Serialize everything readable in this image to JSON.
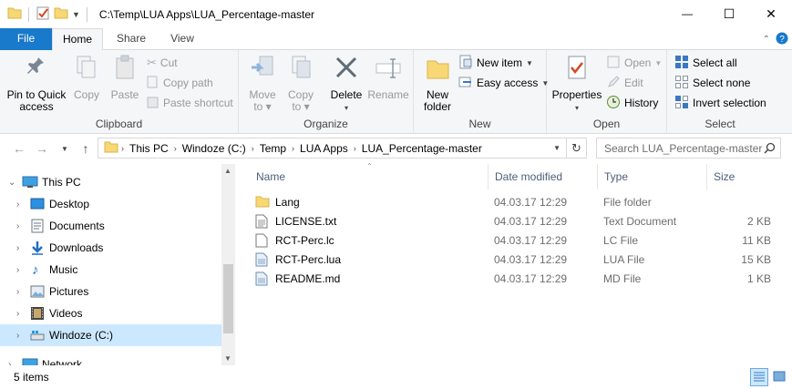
{
  "window": {
    "title": "C:\\Temp\\LUA Apps\\LUA_Percentage-master",
    "minimize_glyph": "—",
    "maximize_glyph": "☐",
    "close_glyph": "✕"
  },
  "ribbon_tabs": {
    "file": "File",
    "home": "Home",
    "share": "Share",
    "view": "View"
  },
  "clipboard": {
    "pin_label_1": "Pin to Quick",
    "pin_label_2": "access",
    "copy": "Copy",
    "paste": "Paste",
    "cut": "Cut",
    "copy_path": "Copy path",
    "paste_shortcut": "Paste shortcut",
    "group": "Clipboard"
  },
  "organize": {
    "move_to_1": "Move",
    "move_to_2": "to ▾",
    "copy_to_1": "Copy",
    "copy_to_2": "to ▾",
    "delete": "Delete",
    "delete_caret": "▾",
    "rename": "Rename",
    "group": "Organize"
  },
  "new": {
    "new_folder_1": "New",
    "new_folder_2": "folder",
    "new_item": "New item",
    "easy_access": "Easy access",
    "group": "New"
  },
  "open": {
    "properties": "Properties",
    "properties_caret": "▾",
    "open": "Open",
    "edit": "Edit",
    "history": "History",
    "group": "Open"
  },
  "select": {
    "select_all": "Select all",
    "select_none": "Select none",
    "invert_selection": "Invert selection",
    "group": "Select"
  },
  "address": {
    "crumbs": [
      "This PC",
      "Windoze (C:)",
      "Temp",
      "LUA Apps",
      "LUA_Percentage-master"
    ],
    "search_placeholder": "Search LUA_Percentage-master"
  },
  "nav": {
    "items": [
      {
        "label": "This PC",
        "icon": "computer-icon"
      },
      {
        "label": "Desktop",
        "icon": "desktop-icon"
      },
      {
        "label": "Documents",
        "icon": "documents-icon"
      },
      {
        "label": "Downloads",
        "icon": "downloads-icon"
      },
      {
        "label": "Music",
        "icon": "music-icon"
      },
      {
        "label": "Pictures",
        "icon": "pictures-icon"
      },
      {
        "label": "Videos",
        "icon": "videos-icon"
      },
      {
        "label": "Windoze (C:)",
        "icon": "drive-icon"
      },
      {
        "label": "Network",
        "icon": "network-icon"
      }
    ]
  },
  "columns": {
    "name": "Name",
    "date_modified": "Date modified",
    "type": "Type",
    "size": "Size"
  },
  "files": [
    {
      "name": "Lang",
      "date": "04.03.17 12:29",
      "type": "File folder",
      "size": "",
      "icon": "folder-icon"
    },
    {
      "name": "LICENSE.txt",
      "date": "04.03.17 12:29",
      "type": "Text Document",
      "size": "2 KB",
      "icon": "text-file-icon"
    },
    {
      "name": "RCT-Perc.lc",
      "date": "04.03.17 12:29",
      "type": "LC File",
      "size": "11 KB",
      "icon": "file-icon"
    },
    {
      "name": "RCT-Perc.lua",
      "date": "04.03.17 12:29",
      "type": "LUA File",
      "size": "15 KB",
      "icon": "lua-file-icon"
    },
    {
      "name": "README.md",
      "date": "04.03.17 12:29",
      "type": "MD File",
      "size": "1 KB",
      "icon": "md-file-icon"
    }
  ],
  "status": {
    "item_count": "5 items"
  },
  "colors": {
    "accent": "#1979ca",
    "selection": "#cce8ff",
    "folder": "#f8d775"
  }
}
